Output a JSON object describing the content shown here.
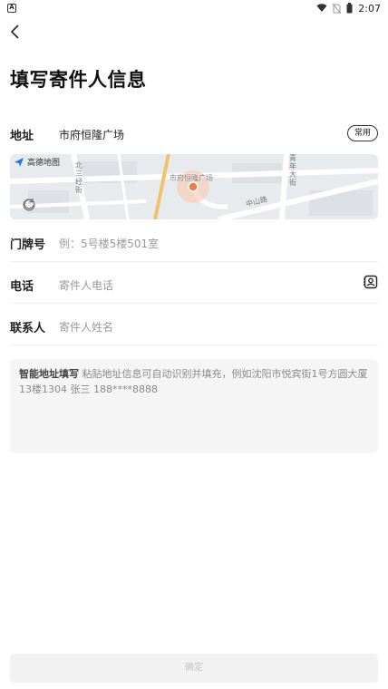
{
  "status_bar": {
    "left_icon": "a-app-icon",
    "icons": [
      "wifi-icon",
      "no-sim-icon",
      "battery-icon"
    ],
    "time": "2:07"
  },
  "header": {
    "back_icon": "chevron-left-icon",
    "title": "填写寄件人信息"
  },
  "form": {
    "address": {
      "label": "地址",
      "value": "市府恒隆广场",
      "tag": "常用"
    },
    "map": {
      "provider": "高德地图",
      "poi_label": "市府恒隆广场",
      "streets": [
        "北三经街",
        "中山路",
        "青年大街"
      ],
      "marker_color": "#f07c3e"
    },
    "door": {
      "label": "门牌号",
      "placeholder": "例：5号楼5楼501室"
    },
    "phone": {
      "label": "电话",
      "placeholder": "寄件人电话",
      "icon": "contacts-icon"
    },
    "contact": {
      "label": "联系人",
      "placeholder": "寄件人姓名"
    },
    "smart_fill": {
      "title": "智能地址填写",
      "hint": "粘贴地址信息可自动识别并填充，例如沈阳市悦宾街1号方圆大厦13楼1304 张三 188****8888"
    }
  },
  "footer": {
    "confirm_label": "确定"
  }
}
